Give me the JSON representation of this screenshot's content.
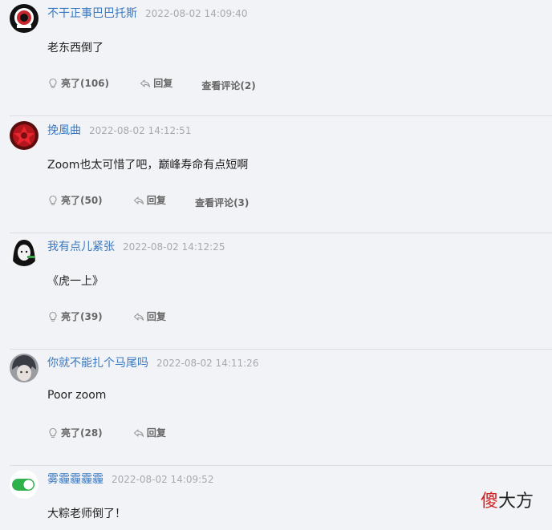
{
  "comments": [
    {
      "user": "不干正事巴巴托斯",
      "time": "2022-08-02 14:09:40",
      "text": "老东西倒了",
      "like_label": "亮了(106)",
      "reply_label": "回复",
      "view_label": "查看评论(2)"
    },
    {
      "user": "挽風曲",
      "time": "2022-08-02 14:12:51",
      "text": "Zoom也太可惜了吧，巅峰寿命有点短啊",
      "like_label": "亮了(50)",
      "reply_label": "回复",
      "view_label": "查看评论(3)"
    },
    {
      "user": "我有点儿紧张",
      "time": "2022-08-02 14:12:25",
      "text": "《虎一上》",
      "like_label": "亮了(39)",
      "reply_label": "回复"
    },
    {
      "user": "你就不能扎个马尾吗",
      "time": "2022-08-02 14:11:26",
      "text": "Poor zoom",
      "like_label": "亮了(28)",
      "reply_label": "回复"
    },
    {
      "user": "雾霾霾霾霾",
      "time": "2022-08-02 14:09:52",
      "text": "大粽老师倒了！"
    }
  ],
  "watermark": {
    "part1": "傻",
    "part2": "大方"
  },
  "colors": {
    "username": "#3a79c1",
    "time": "#a6a9b0",
    "background": "#f2f3f6"
  },
  "icons": {
    "like": "lightbulb-icon",
    "reply": "reply-arrow-icon"
  }
}
